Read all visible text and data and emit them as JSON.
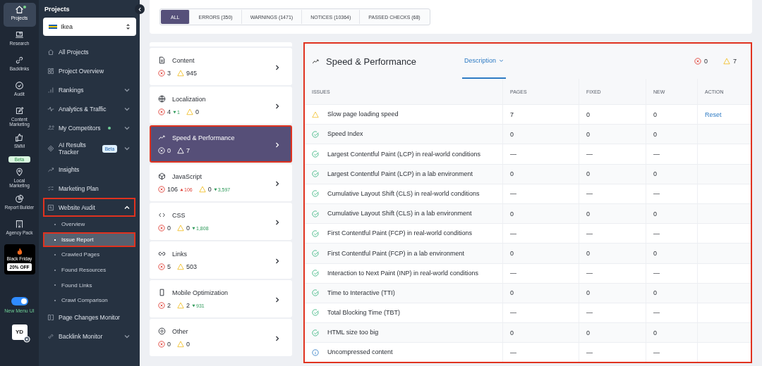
{
  "rail": {
    "items": [
      {
        "label": "Projects",
        "selected": true,
        "notification": true
      },
      {
        "label": "Research",
        "selected": false,
        "notification": false
      },
      {
        "label": "Backlinks",
        "selected": false,
        "notification": false
      },
      {
        "label": "Audit",
        "selected": false,
        "notification": false
      },
      {
        "label": "Content Marketing",
        "selected": false,
        "notification": false
      },
      {
        "label": "SMM",
        "selected": false,
        "notification": false,
        "badge": "Beta"
      },
      {
        "label": "Local Marketing",
        "selected": false,
        "notification": false
      },
      {
        "label": "Report Builder",
        "selected": false,
        "notification": false
      },
      {
        "label": "Agency Pack",
        "selected": false,
        "notification": false
      }
    ],
    "promo": {
      "title": "Black Friday",
      "offer": "20% OFF"
    },
    "toggle": {
      "label": "New Menu UI",
      "on": true
    },
    "avatar": "YD"
  },
  "sidebar": {
    "title": "Projects",
    "project": "Ikea",
    "items": [
      {
        "label": "All Projects",
        "kind": "link",
        "selected": false,
        "highlighted": false
      },
      {
        "label": "Project Overview",
        "kind": "link",
        "selected": false,
        "highlighted": false
      },
      {
        "label": "Rankings",
        "kind": "group",
        "expanded": false,
        "selected": false,
        "highlighted": false,
        "notification": false
      },
      {
        "label": "Analytics & Traffic",
        "kind": "group",
        "expanded": false,
        "selected": false,
        "highlighted": false,
        "notification": false
      },
      {
        "label": "My Competitors",
        "kind": "group",
        "expanded": false,
        "selected": false,
        "highlighted": false,
        "notification": true
      },
      {
        "label": "AI Results Tracker",
        "kind": "group",
        "expanded": false,
        "selected": false,
        "highlighted": false,
        "notification": false,
        "badge": "Beta"
      },
      {
        "label": "Insights",
        "kind": "link",
        "selected": false,
        "highlighted": false
      },
      {
        "label": "Marketing Plan",
        "kind": "link",
        "selected": false,
        "highlighted": false
      },
      {
        "label": "Website Audit",
        "kind": "group",
        "expanded": true,
        "selected": false,
        "highlighted": true,
        "notification": false
      },
      {
        "label": "Overview",
        "kind": "sub",
        "selected": false,
        "highlighted": false
      },
      {
        "label": "Issue Report",
        "kind": "sub",
        "selected": true,
        "highlighted": true
      },
      {
        "label": "Crawled Pages",
        "kind": "sub",
        "selected": false,
        "highlighted": false
      },
      {
        "label": "Found Resources",
        "kind": "sub",
        "selected": false,
        "highlighted": false
      },
      {
        "label": "Found Links",
        "kind": "sub",
        "selected": false,
        "highlighted": false
      },
      {
        "label": "Crawl Comparison",
        "kind": "sub",
        "selected": false,
        "highlighted": false
      },
      {
        "label": "Page Changes Monitor",
        "kind": "link",
        "selected": false,
        "highlighted": false
      },
      {
        "label": "Backlink Monitor",
        "kind": "group",
        "expanded": false,
        "selected": false,
        "highlighted": false,
        "notification": false
      }
    ]
  },
  "filters": [
    {
      "label": "ALL",
      "selected": true
    },
    {
      "label": "ERRORS (350)",
      "selected": false
    },
    {
      "label": "WARNINGS (1471)",
      "selected": false
    },
    {
      "label": "NOTICES (10364)",
      "selected": false
    },
    {
      "label": "PASSED CHECKS (68)",
      "selected": false
    }
  ],
  "categories": [
    {
      "name": "Content",
      "errors": "3",
      "warnings": "945",
      "selected": false,
      "highlighted": false
    },
    {
      "name": "Localization",
      "errors": "4",
      "errors_delta": {
        "value": "1",
        "kind": "decrease"
      },
      "warnings": "0",
      "selected": false,
      "highlighted": false
    },
    {
      "name": "Speed & Performance",
      "errors": "0",
      "warnings": "7",
      "selected": true,
      "highlighted": true
    },
    {
      "name": "JavaScript",
      "errors": "106",
      "errors_delta": {
        "value": "106",
        "kind": "increase"
      },
      "warnings": "0",
      "warnings_delta": {
        "value": "3,597",
        "kind": "decrease"
      },
      "selected": false,
      "highlighted": false
    },
    {
      "name": "CSS",
      "errors": "0",
      "warnings": "0",
      "warnings_delta": {
        "value": "1,808",
        "kind": "decrease"
      },
      "selected": false,
      "highlighted": false
    },
    {
      "name": "Links",
      "errors": "5",
      "warnings": "503",
      "selected": false,
      "highlighted": false
    },
    {
      "name": "Mobile Optimization",
      "errors": "2",
      "warnings": "2",
      "warnings_delta": {
        "value": "931",
        "kind": "decrease"
      },
      "selected": false,
      "highlighted": false
    },
    {
      "name": "Other",
      "errors": "0",
      "warnings": "0",
      "selected": false,
      "highlighted": false
    }
  ],
  "panel": {
    "title": "Speed & Performance",
    "highlighted": true,
    "description_link": "Description",
    "errors": "0",
    "warnings": "7",
    "table": {
      "columns": [
        "ISSUES",
        "PAGES",
        "FIXED",
        "NEW",
        "ACTION"
      ],
      "rows": [
        {
          "kind": "warning",
          "issue": "Slow page loading speed",
          "pages": "7",
          "fixed": "0",
          "new": "0",
          "action": "Reset"
        },
        {
          "kind": "passed",
          "issue": "Speed Index",
          "pages": "0",
          "fixed": "0",
          "new": "0"
        },
        {
          "kind": "passed",
          "issue": "Largest Contentful Paint (LCP) in real-world conditions",
          "pages": "—",
          "fixed": "—",
          "new": "—"
        },
        {
          "kind": "passed",
          "issue": "Largest Contentful Paint (LCP) in a lab environment",
          "pages": "0",
          "fixed": "0",
          "new": "0"
        },
        {
          "kind": "passed",
          "issue": "Cumulative Layout Shift (CLS) in real-world conditions",
          "pages": "—",
          "fixed": "—",
          "new": "—"
        },
        {
          "kind": "passed",
          "issue": "Cumulative Layout Shift (CLS) in a lab environment",
          "pages": "0",
          "fixed": "0",
          "new": "0"
        },
        {
          "kind": "passed",
          "issue": "First Contentful Paint (FCP) in real-world conditions",
          "pages": "—",
          "fixed": "—",
          "new": "—"
        },
        {
          "kind": "passed",
          "issue": "First Contentful Paint (FCP) in a lab environment",
          "pages": "0",
          "fixed": "0",
          "new": "0"
        },
        {
          "kind": "passed",
          "issue": "Interaction to Next Paint (INP) in real-world conditions",
          "pages": "—",
          "fixed": "—",
          "new": "—"
        },
        {
          "kind": "passed",
          "issue": "Time to Interactive (TTI)",
          "pages": "0",
          "fixed": "0",
          "new": "0"
        },
        {
          "kind": "passed",
          "issue": "Total Blocking Time (TBT)",
          "pages": "—",
          "fixed": "—",
          "new": "—"
        },
        {
          "kind": "passed",
          "issue": "HTML size too big",
          "pages": "0",
          "fixed": "0",
          "new": "0"
        },
        {
          "kind": "info",
          "issue": "Uncompressed content",
          "pages": "—",
          "fixed": "—",
          "new": "—"
        }
      ]
    }
  }
}
